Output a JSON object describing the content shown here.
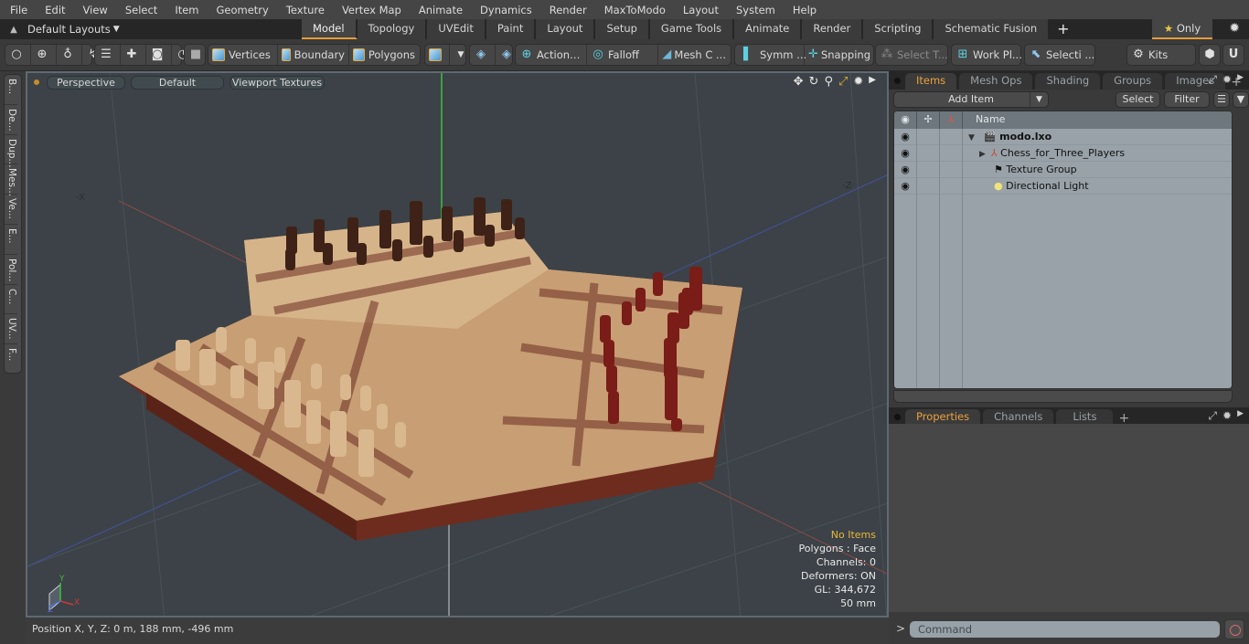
{
  "menu": [
    "File",
    "Edit",
    "View",
    "Select",
    "Item",
    "Geometry",
    "Texture",
    "Vertex Map",
    "Animate",
    "Dynamics",
    "Render",
    "MaxToModo",
    "Layout",
    "System",
    "Help"
  ],
  "layouts": {
    "label": "Default Layouts",
    "tabs": [
      "Model",
      "Topology",
      "UVEdit",
      "Paint",
      "Layout",
      "Setup",
      "Game Tools",
      "Animate",
      "Render",
      "Scripting",
      "Schematic Fusion"
    ],
    "active": "Model",
    "only_label": "Only"
  },
  "toolbar": {
    "vertices": "Vertices",
    "boundary": "Boundary",
    "polygons": "Polygons",
    "action": "Action",
    "falloff": "Falloff",
    "mesh": "Mesh C ...",
    "symm": "Symm ...",
    "snapping": "Snapping",
    "select_t": "Select T...",
    "work_plane": "Work Pl...",
    "selection": "Selecti ...",
    "kits": "Kits"
  },
  "left_strip": [
    "B...",
    "De...",
    "Dup...",
    "Mes...",
    "Ve...",
    "E...",
    "Pol...",
    "C...",
    "UV...",
    "F..."
  ],
  "viewport": {
    "view": "Perspective",
    "shading": "Default",
    "textures": "Viewport Textures",
    "axis_labels": {
      "neg_x": "-X",
      "neg_z": "-Z"
    },
    "stats": {
      "items": "No Items",
      "polygons": "Polygons : Face",
      "channels": "Channels: 0",
      "deformers": "Deformers: ON",
      "gl": "GL: 344,672",
      "scale": "50 mm"
    }
  },
  "status": {
    "position": "Position X, Y, Z:   0 m, 188 mm, -496 mm"
  },
  "items_panel": {
    "tabs": [
      "Items",
      "Mesh Ops",
      "Shading",
      "Groups",
      "Images"
    ],
    "active": "Items",
    "add_item": "Add Item",
    "select": "Select",
    "filter": "Filter",
    "name_header": "Name",
    "rows": [
      {
        "name": "modo.lxo",
        "bold": true,
        "icon": "scene-icon"
      },
      {
        "name": "Chess_for_Three_Players",
        "icon": "mesh-locator-icon"
      },
      {
        "name": "Texture Group",
        "icon": "texture-group-icon"
      },
      {
        "name": "Directional Light",
        "icon": "light-icon"
      }
    ]
  },
  "properties_panel": {
    "tabs": [
      "Properties",
      "Channels",
      "Lists"
    ],
    "active": "Properties"
  },
  "command": {
    "placeholder": "Command",
    "prompt": ">"
  }
}
